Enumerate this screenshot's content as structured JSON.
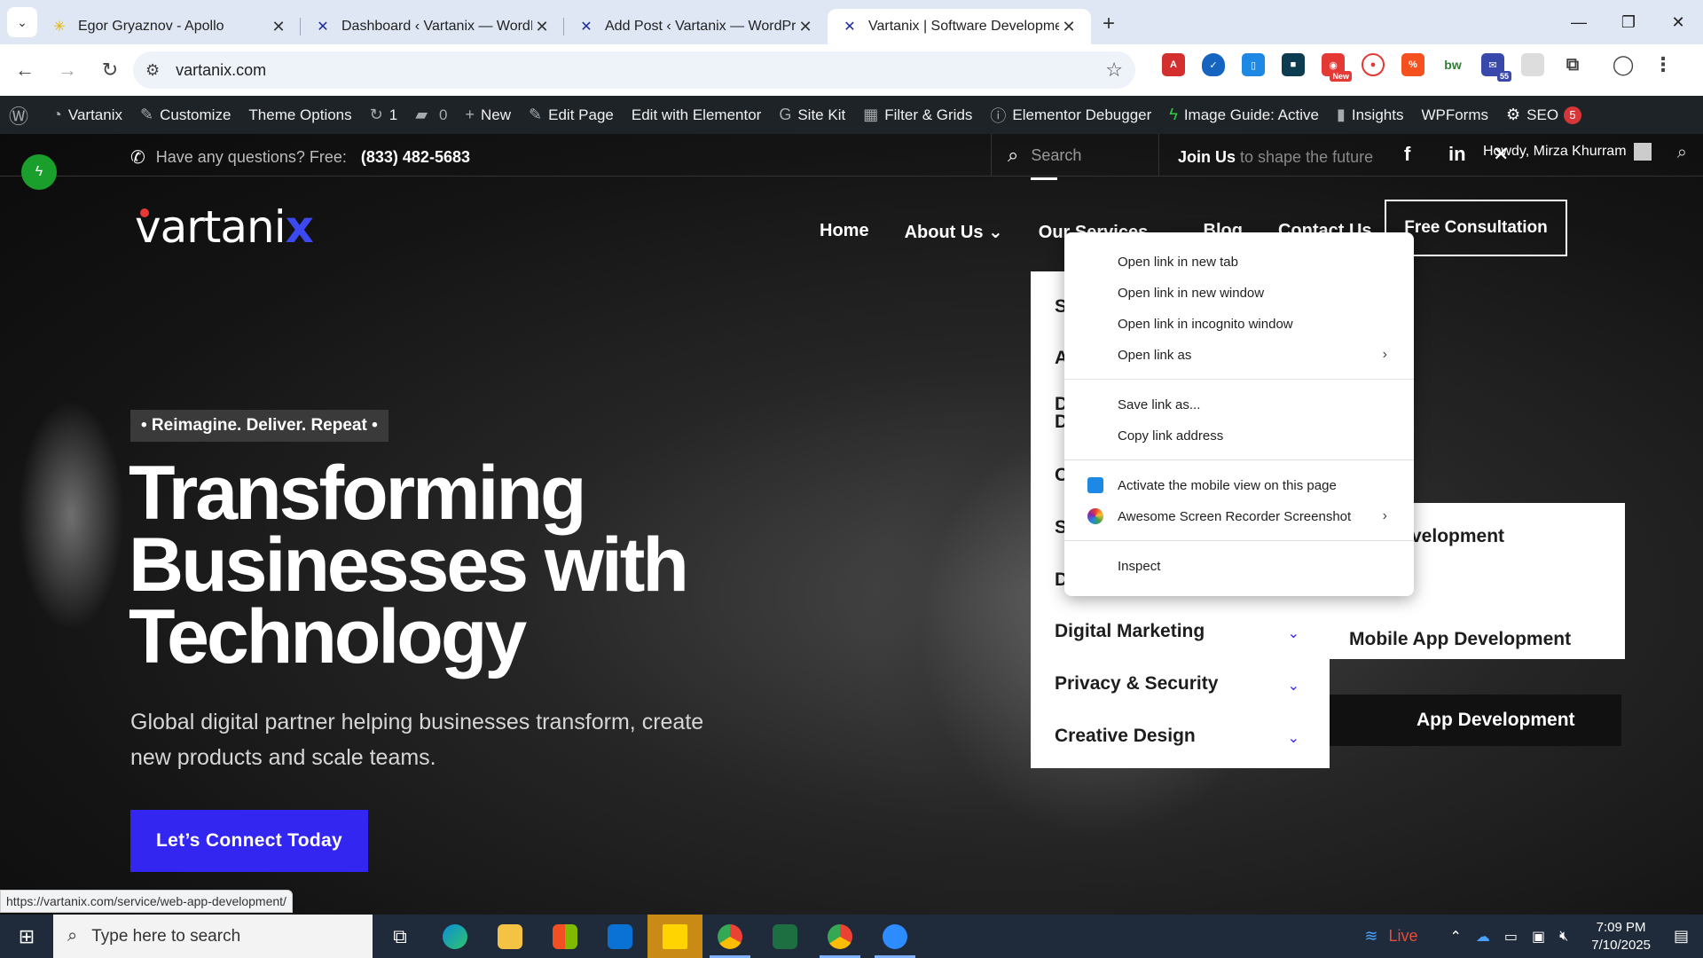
{
  "browser": {
    "tabs": [
      {
        "title": "Egor Gryaznov - Apollo",
        "favicon_color": "#e8b400",
        "active": false
      },
      {
        "title": "Dashboard ‹ Vartanix — WordPress",
        "favicon_color": "#1b2a9c",
        "active": false
      },
      {
        "title": "Add Post ‹ Vartanix — WordPress",
        "favicon_color": "#1b2a9c",
        "active": false
      },
      {
        "title": "Vartanix | Software Development",
        "favicon_color": "#1b2a9c",
        "active": true
      }
    ],
    "url": "vartanix.com",
    "extensions": [
      "acrobat-icon",
      "shield-icon",
      "document-icon",
      "folder-icon",
      "new-badge-icon",
      "pokeball-icon",
      "percent-icon",
      "bw-icon",
      "mail-55-icon",
      "puzzle-icon",
      "profile-icon"
    ],
    "ext_new_badge": "New",
    "ext_mail_badge": "55",
    "ext_bw_label": "bw"
  },
  "wpbar": {
    "site": "Vartanix",
    "customize": "Customize",
    "theme_options": "Theme Options",
    "updates_count": "1",
    "comments_count": "0",
    "new": "New",
    "edit_page": "Edit Page",
    "edit_elementor": "Edit with Elementor",
    "site_kit": "Site Kit",
    "filter_grids": "Filter & Grids",
    "elementor_debugger": "Elementor Debugger",
    "image_guide": "Image Guide: Active",
    "insights": "Insights",
    "wpforms": "WPForms",
    "seo": "SEO",
    "seo_count": "5"
  },
  "site": {
    "topbar": {
      "question": "Have any questions? Free:",
      "phone": "(833) 482-5683",
      "search_placeholder": "Search",
      "join_bold": "Join Us",
      "join_rest": " to shape the future",
      "howdy": "Howdy, Mirza Khurram"
    },
    "logo": {
      "main": "vartani",
      "accent": "x"
    },
    "nav": [
      "Home",
      "About Us ⌄",
      "Our Services ⌄",
      "Blog",
      "Contact Us"
    ],
    "cta": "Free Consultation",
    "hero": {
      "tagline": "• Reimagine. Deliver. Repeat •",
      "title": "Transforming Businesses with Technology",
      "subtitle": "Global digital partner helping businesses transform, create new products and scale teams.",
      "button": "Let’s Connect Today"
    },
    "services_menu": [
      {
        "label": "S",
        "y": 0
      },
      {
        "label": "A",
        "y": 0
      },
      {
        "label": "D\nD",
        "y": 0
      },
      {
        "label": "C",
        "y": 0
      },
      {
        "label": "S",
        "y": 0
      },
      {
        "label": "D",
        "y": 0
      },
      {
        "label": "Digital Marketing"
      },
      {
        "label": "Privacy & Security"
      },
      {
        "label": "Creative Design"
      }
    ],
    "submenu": [
      "velopment",
      "App Development",
      "Mobile App Development"
    ]
  },
  "context_menu": {
    "items": [
      "Open link in new tab",
      "Open link in new window",
      "Open link in incognito window",
      "Open link as",
      "Save link as...",
      "Copy link address",
      "Activate the mobile view on this page",
      "Awesome Screen Recorder  Screenshot",
      "Inspect"
    ]
  },
  "status_url": "https://vartanix.com/service/web-app-development/",
  "taskbar": {
    "search_placeholder": "Type here to search",
    "live": "Live",
    "time": "7:09 PM",
    "date": "7/10/2025"
  }
}
